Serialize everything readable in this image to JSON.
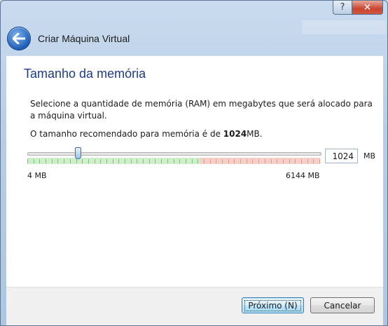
{
  "window": {
    "title": "Criar Máquina Virtual",
    "help_glyph": "?",
    "close_glyph": "✕"
  },
  "page": {
    "title": "Tamanho da memória",
    "description": "Selecione a quantidade de memória (RAM) em megabytes que será alocado para a máquina virtual.",
    "recommend_prefix": "O tamanho recomendado para memória é de ",
    "recommend_value": "1024",
    "recommend_suffix": "MB."
  },
  "memory": {
    "min_label": "4 MB",
    "max_label": "6144 MB",
    "min_mb": 4,
    "max_mb": 6144,
    "value_mb": 1024,
    "input_value": "1024",
    "unit": "MB",
    "green_fraction": 0.59
  },
  "buttons": {
    "next_label": "Próximo (N)",
    "cancel_label": "Cancelar"
  },
  "colors": {
    "title_blue": "#1e3b8b",
    "safe_range": "#cfeecb",
    "warn_range": "#f6d0c8"
  }
}
